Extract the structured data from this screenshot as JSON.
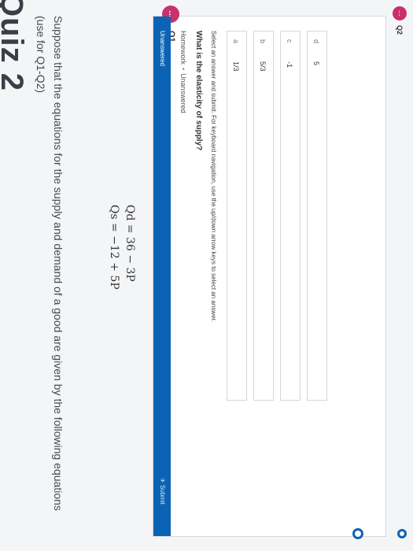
{
  "quiz": {
    "title": "Quiz 2",
    "intro": "Suppose that the equations for the supply and demand of a good are given by the following equations (use for Q1-Q2)",
    "equations": [
      "Qd = 36 − 3P",
      "Qs = −12 + 5P"
    ]
  },
  "question1": {
    "icon_text": "...",
    "number": "Q1",
    "type": "Homework",
    "status": "Unanswered",
    "text": "What is the elasticity of supply?",
    "instructions": "Select an answer and submit. For keyboard navigation, use the up/down arrow keys to select an answer.",
    "choices": [
      {
        "letter": "a",
        "value": "1/3"
      },
      {
        "letter": "b",
        "value": "5/3"
      },
      {
        "letter": "c",
        "value": "-1"
      },
      {
        "letter": "d",
        "value": "5"
      }
    ],
    "footer_status": "Unanswered",
    "submit_label": "Submit"
  },
  "question2": {
    "icon_text": "...",
    "number": "Q2"
  }
}
